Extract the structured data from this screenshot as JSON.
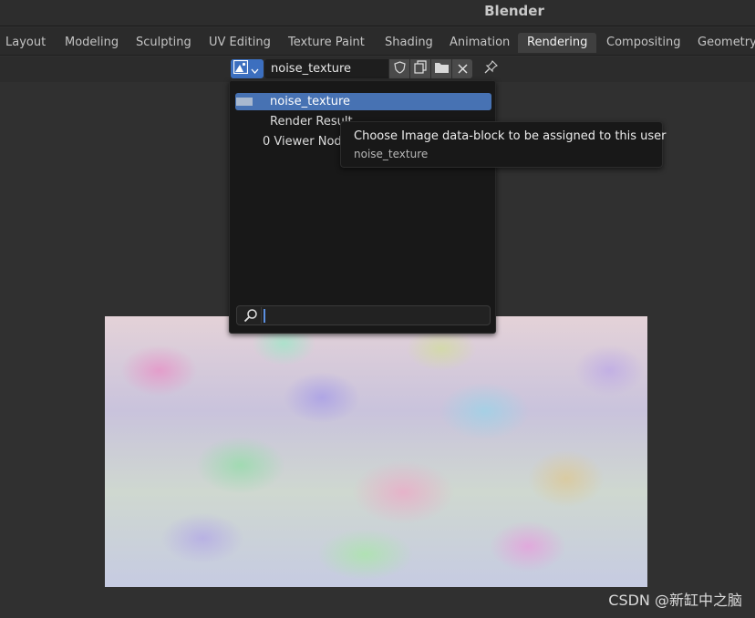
{
  "app": {
    "title": "Blender"
  },
  "workspace_tabs": [
    {
      "label": "Layout",
      "active": false
    },
    {
      "label": "Modeling",
      "active": false
    },
    {
      "label": "Sculpting",
      "active": false
    },
    {
      "label": "UV Editing",
      "active": false
    },
    {
      "label": "Texture Paint",
      "active": false
    },
    {
      "label": "Shading",
      "active": false
    },
    {
      "label": "Animation",
      "active": false
    },
    {
      "label": "Rendering",
      "active": true
    },
    {
      "label": "Compositing",
      "active": false
    },
    {
      "label": "Geometry",
      "active": false
    }
  ],
  "image_header": {
    "image_name": "noise_texture",
    "icons": {
      "browse": "image-browse-icon",
      "fake_user": "shield-icon",
      "duplicate": "duplicate-icon",
      "open": "folder-icon",
      "unlink": "close-icon",
      "pin": "pin-icon"
    }
  },
  "image_browser": {
    "items": [
      {
        "label": "noise_texture",
        "selected": true
      },
      {
        "label": "Render Result",
        "selected": false
      },
      {
        "label": "0 Viewer Node",
        "selected": false
      }
    ],
    "search_value": "",
    "search_icon": "search-icon"
  },
  "tooltip": {
    "title": "Choose Image data-block to be assigned to this user",
    "value": "noise_texture"
  },
  "watermark": "CSDN @新缸中之脑",
  "colors": {
    "accent": "#4772b3",
    "background": "#303030",
    "popup": "#181818"
  }
}
